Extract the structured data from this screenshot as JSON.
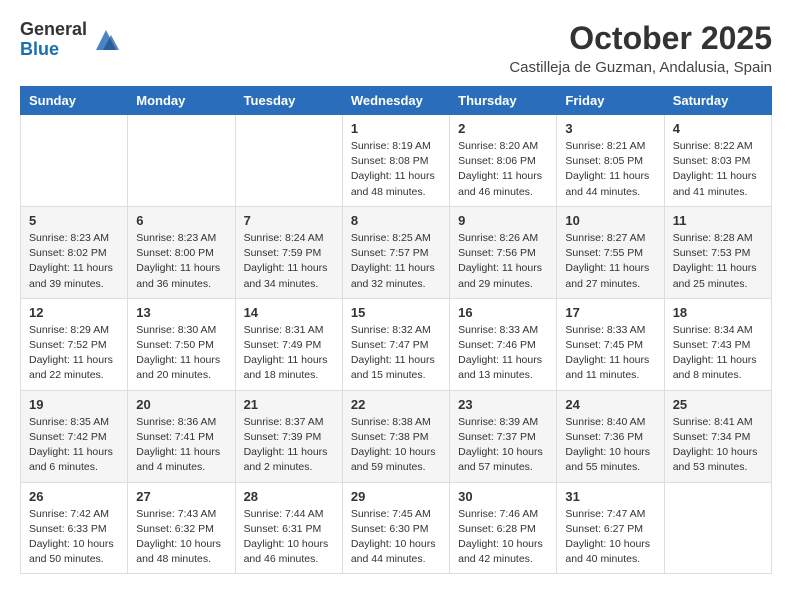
{
  "header": {
    "logo_line1": "General",
    "logo_line2": "Blue",
    "month_title": "October 2025",
    "location": "Castilleja de Guzman, Andalusia, Spain"
  },
  "weekdays": [
    "Sunday",
    "Monday",
    "Tuesday",
    "Wednesday",
    "Thursday",
    "Friday",
    "Saturday"
  ],
  "weeks": [
    [
      {
        "day": "",
        "info": ""
      },
      {
        "day": "",
        "info": ""
      },
      {
        "day": "",
        "info": ""
      },
      {
        "day": "1",
        "info": "Sunrise: 8:19 AM\nSunset: 8:08 PM\nDaylight: 11 hours\nand 48 minutes."
      },
      {
        "day": "2",
        "info": "Sunrise: 8:20 AM\nSunset: 8:06 PM\nDaylight: 11 hours\nand 46 minutes."
      },
      {
        "day": "3",
        "info": "Sunrise: 8:21 AM\nSunset: 8:05 PM\nDaylight: 11 hours\nand 44 minutes."
      },
      {
        "day": "4",
        "info": "Sunrise: 8:22 AM\nSunset: 8:03 PM\nDaylight: 11 hours\nand 41 minutes."
      }
    ],
    [
      {
        "day": "5",
        "info": "Sunrise: 8:23 AM\nSunset: 8:02 PM\nDaylight: 11 hours\nand 39 minutes."
      },
      {
        "day": "6",
        "info": "Sunrise: 8:23 AM\nSunset: 8:00 PM\nDaylight: 11 hours\nand 36 minutes."
      },
      {
        "day": "7",
        "info": "Sunrise: 8:24 AM\nSunset: 7:59 PM\nDaylight: 11 hours\nand 34 minutes."
      },
      {
        "day": "8",
        "info": "Sunrise: 8:25 AM\nSunset: 7:57 PM\nDaylight: 11 hours\nand 32 minutes."
      },
      {
        "day": "9",
        "info": "Sunrise: 8:26 AM\nSunset: 7:56 PM\nDaylight: 11 hours\nand 29 minutes."
      },
      {
        "day": "10",
        "info": "Sunrise: 8:27 AM\nSunset: 7:55 PM\nDaylight: 11 hours\nand 27 minutes."
      },
      {
        "day": "11",
        "info": "Sunrise: 8:28 AM\nSunset: 7:53 PM\nDaylight: 11 hours\nand 25 minutes."
      }
    ],
    [
      {
        "day": "12",
        "info": "Sunrise: 8:29 AM\nSunset: 7:52 PM\nDaylight: 11 hours\nand 22 minutes."
      },
      {
        "day": "13",
        "info": "Sunrise: 8:30 AM\nSunset: 7:50 PM\nDaylight: 11 hours\nand 20 minutes."
      },
      {
        "day": "14",
        "info": "Sunrise: 8:31 AM\nSunset: 7:49 PM\nDaylight: 11 hours\nand 18 minutes."
      },
      {
        "day": "15",
        "info": "Sunrise: 8:32 AM\nSunset: 7:47 PM\nDaylight: 11 hours\nand 15 minutes."
      },
      {
        "day": "16",
        "info": "Sunrise: 8:33 AM\nSunset: 7:46 PM\nDaylight: 11 hours\nand 13 minutes."
      },
      {
        "day": "17",
        "info": "Sunrise: 8:33 AM\nSunset: 7:45 PM\nDaylight: 11 hours\nand 11 minutes."
      },
      {
        "day": "18",
        "info": "Sunrise: 8:34 AM\nSunset: 7:43 PM\nDaylight: 11 hours\nand 8 minutes."
      }
    ],
    [
      {
        "day": "19",
        "info": "Sunrise: 8:35 AM\nSunset: 7:42 PM\nDaylight: 11 hours\nand 6 minutes."
      },
      {
        "day": "20",
        "info": "Sunrise: 8:36 AM\nSunset: 7:41 PM\nDaylight: 11 hours\nand 4 minutes."
      },
      {
        "day": "21",
        "info": "Sunrise: 8:37 AM\nSunset: 7:39 PM\nDaylight: 11 hours\nand 2 minutes."
      },
      {
        "day": "22",
        "info": "Sunrise: 8:38 AM\nSunset: 7:38 PM\nDaylight: 10 hours\nand 59 minutes."
      },
      {
        "day": "23",
        "info": "Sunrise: 8:39 AM\nSunset: 7:37 PM\nDaylight: 10 hours\nand 57 minutes."
      },
      {
        "day": "24",
        "info": "Sunrise: 8:40 AM\nSunset: 7:36 PM\nDaylight: 10 hours\nand 55 minutes."
      },
      {
        "day": "25",
        "info": "Sunrise: 8:41 AM\nSunset: 7:34 PM\nDaylight: 10 hours\nand 53 minutes."
      }
    ],
    [
      {
        "day": "26",
        "info": "Sunrise: 7:42 AM\nSunset: 6:33 PM\nDaylight: 10 hours\nand 50 minutes."
      },
      {
        "day": "27",
        "info": "Sunrise: 7:43 AM\nSunset: 6:32 PM\nDaylight: 10 hours\nand 48 minutes."
      },
      {
        "day": "28",
        "info": "Sunrise: 7:44 AM\nSunset: 6:31 PM\nDaylight: 10 hours\nand 46 minutes."
      },
      {
        "day": "29",
        "info": "Sunrise: 7:45 AM\nSunset: 6:30 PM\nDaylight: 10 hours\nand 44 minutes."
      },
      {
        "day": "30",
        "info": "Sunrise: 7:46 AM\nSunset: 6:28 PM\nDaylight: 10 hours\nand 42 minutes."
      },
      {
        "day": "31",
        "info": "Sunrise: 7:47 AM\nSunset: 6:27 PM\nDaylight: 10 hours\nand 40 minutes."
      },
      {
        "day": "",
        "info": ""
      }
    ]
  ]
}
